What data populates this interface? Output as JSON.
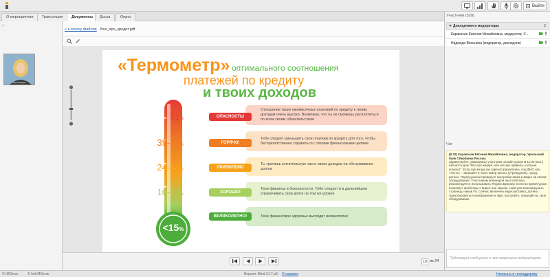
{
  "topbar": {
    "exit_label": "Выйти",
    "icons": [
      "monitor-icon",
      "network-icon",
      "hand-icon",
      "mic-icon",
      "gear-icon"
    ]
  },
  "tabs": [
    {
      "label": "О мероприятии"
    },
    {
      "label": "Трансляция"
    },
    {
      "label": "Документы"
    },
    {
      "label": "Доска"
    },
    {
      "label": "Опрос"
    }
  ],
  "webcam": {
    "label": "Ирина Вадим"
  },
  "doc": {
    "back_link": "« к списку файлов",
    "file_name": "Все_про_кредит.pdf"
  },
  "slide": {
    "title_quote": "«Термометр»",
    "title_line1": "оптимального соотношения",
    "title_line2": "платежей по кредиту",
    "title_line3": "и твоих доходов",
    "thermo_value": "<15",
    "thermo_unit": "%",
    "levels": [
      {
        "value": "51",
        "unit": "%",
        "label": "ОПАСНОСТЬ!",
        "color": "#e53935",
        "bg": "#fbd4c6",
        "text": "Отношение твоих ежемесячных платежей по кредиту к твоим доходам очень высоко. Возможно, что ты не сможешь расплатиться по всем своим обязательствам"
      },
      {
        "value": "39-50",
        "unit": "%",
        "label": "ГОРЯЧО!",
        "color": "#ef7d22",
        "bg": "#fde1c6",
        "text": "Тебе следует уменьшить свои платежи по кредиту для того, чтобы беспрепятственно справиться с своими финансовыми целями"
      },
      {
        "value": "24-38",
        "unit": "%",
        "label": "ПРИЕМЛЕМО",
        "color": "#f6a21b",
        "bg": "#feebc4",
        "text": "Ты тратишь значительную часть своих доходов на обслуживание долгов"
      },
      {
        "value": "16-23",
        "unit": "%",
        "label": "ХОРОШО!",
        "color": "#a6cf5e",
        "bg": "#e6f1d0",
        "text": "Твои финансы в безопасности. Тебе следует и в дальнейшем ограничивать свои долги на том же уровне"
      },
      {
        "value": "",
        "unit": "",
        "label": "ВЕЛИКОЛЕПНО!",
        "color": "#4cad3a",
        "bg": "#d6ebc9",
        "text": "Твоё финансовое здоровье выглядит великолепно"
      }
    ]
  },
  "pager": {
    "current": "10",
    "of_label": "из 24"
  },
  "participants": {
    "title": "Участники (320)",
    "group_title": "Докладчики и модераторы",
    "group_count": "2",
    "list": [
      {
        "name": "Каракачан Евгения Михайловна, модератор, У..."
      },
      {
        "name": "Надежда Вяльнина (модератор, докладчик)"
      }
    ]
  },
  "chat": {
    "title": "Чат",
    "header": "(9:32) Каракачан Евгения Михайловна, модератор, Уральский банк Сбербанка России:",
    "body": "Здравствуйте, уважаемые участники онлайн-урока! В 11:00 (мск.) начнется урок \"Все про кредит или четыре правила, которые помогут\". Если при входе вы зарегистрировались под ФИО или «Гость» - напишите в чате номер школы (учреждения), город, регион. Перед уроком проверьте настройки звука и видео на своем оборудовании. Участникам вебинаров настоятельно рекомендуется использовать Яндекс.Браузер. Если во время урока возникнут проблемы с видео или звуком, советуем перезагрузить страницу, нажав F5. Сейчас включена видеозаставка, дотёны транслироваться изображение и звук, настройте, пожалуйста, свое оборудование.",
    "input_placeholder": "Публикация сообщений в чат запрещена модератором"
  },
  "status": {
    "left1": "© IMGenic",
    "left2": "© Intl iMGenic",
    "version": "Версия: Mind 3.17-p6",
    "about": "О сервисе",
    "right": "Написать в техподдержку"
  }
}
